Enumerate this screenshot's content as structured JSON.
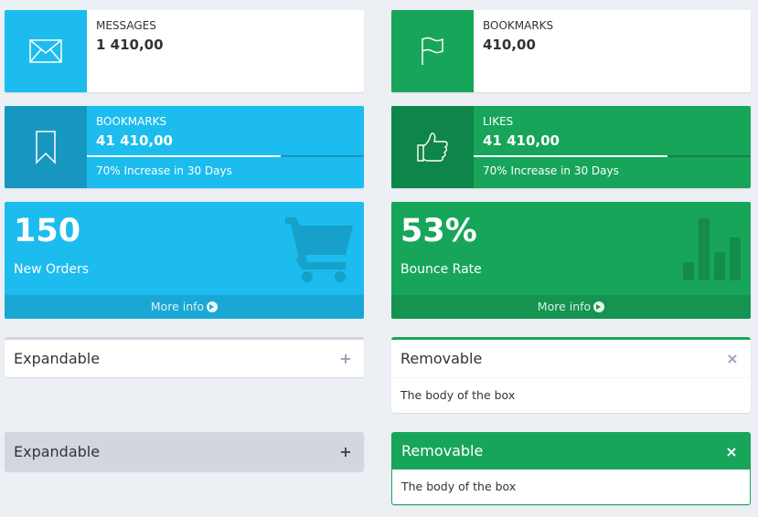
{
  "info_boxes": [
    {
      "label": "MESSAGES",
      "value": "1 410,00",
      "icon": "envelope-icon"
    },
    {
      "label": "BOOKMARKS",
      "value": "410,00",
      "icon": "flag-icon"
    }
  ],
  "progress_boxes": [
    {
      "label": "BOOKMARKS",
      "value": "41 410,00",
      "progress": 70,
      "description": "70% Increase in 30 Days",
      "icon": "bookmark-icon"
    },
    {
      "label": "LIKES",
      "value": "41 410,00",
      "progress": 70,
      "description": "70% Increase in 30 Days",
      "icon": "thumbs-up-icon"
    }
  ],
  "small_boxes": [
    {
      "number": "150",
      "label": "New Orders",
      "link": "More info",
      "icon": "shopping-cart-icon"
    },
    {
      "number": "53%",
      "label": "Bounce Rate",
      "link": "More info",
      "icon": "bar-chart-icon"
    }
  ],
  "boxes": [
    {
      "title": "Expandable",
      "tool": "+",
      "tool_icon": "plus-icon"
    },
    {
      "title": "Removable",
      "tool": "×",
      "tool_icon": "close-icon",
      "body": "The body of the box"
    },
    {
      "title": "Expandable",
      "tool": "+",
      "tool_icon": "plus-icon"
    },
    {
      "title": "Removable",
      "tool": "×",
      "tool_icon": "close-icon",
      "body": "The body of the box"
    }
  ],
  "colors": {
    "aqua": "#1cbcee",
    "aqua_dark": "#1797c0",
    "green": "#17a55a",
    "green_dark": "#0f8649",
    "background": "#ecf0f5"
  }
}
